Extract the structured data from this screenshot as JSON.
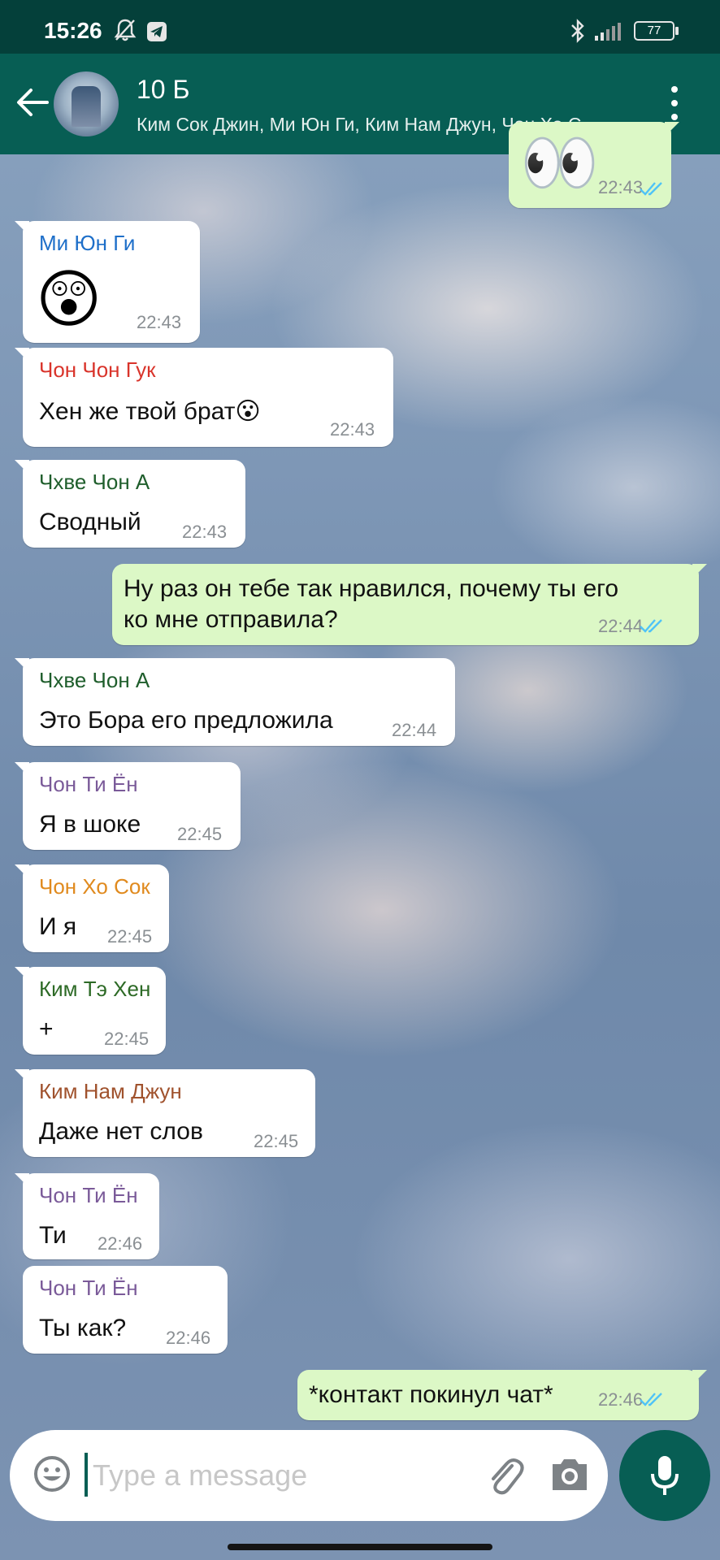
{
  "status_bar": {
    "time": "15:26",
    "battery": "77",
    "icons": [
      "mute-bell-icon",
      "telegram-icon",
      "bluetooth-icon",
      "signal-icon",
      "battery-icon"
    ]
  },
  "header": {
    "title": "10 Б",
    "subtitle": "Ким Сок Джин, Ми Юн Ги, Ким Нам Джун, Чон Хо С..",
    "icons": [
      "back-arrow-icon",
      "group-avatar",
      "more-vert-icon"
    ]
  },
  "colors": {
    "app_bar": "#075e54",
    "status_bar": "#04403a",
    "outgoing_bubble": "#dcf8c6",
    "incoming_bubble": "#ffffff",
    "read_ticks": "#4fc3f7"
  },
  "messages": [
    {
      "direction": "out",
      "emoji": "👀",
      "time": "22:43",
      "status": "read"
    },
    {
      "direction": "in",
      "sender": "Ми Юн Ги",
      "sender_color": "#1e6fc9",
      "emoji": "😲",
      "time": "22:43"
    },
    {
      "direction": "in",
      "sender": "Чон Чон Гук",
      "sender_color": "#d9342b",
      "text": "Хен же твой брат😮",
      "time": "22:43"
    },
    {
      "direction": "in",
      "sender": "Чхве Чон А",
      "sender_color": "#1f5e2c",
      "text": "Сводный",
      "time": "22:43"
    },
    {
      "direction": "out",
      "text_lines": [
        "Ну раз он тебе так нравился, почему ты его",
        "ко мне отправила?"
      ],
      "time": "22:44",
      "status": "read"
    },
    {
      "direction": "in",
      "sender": "Чхве Чон А",
      "sender_color": "#1f5e2c",
      "text": "Это Бора его предложила",
      "time": "22:44"
    },
    {
      "direction": "in",
      "sender": "Чон Ти Ён",
      "sender_color": "#7a5a99",
      "text": "Я в шоке",
      "time": "22:45"
    },
    {
      "direction": "in",
      "sender": "Чон Хо Сок",
      "sender_color": "#e08a1e",
      "text": "И я",
      "time": "22:45"
    },
    {
      "direction": "in",
      "sender": "Ким Тэ Хен",
      "sender_color": "#2d6a26",
      "text": "+",
      "time": "22:45"
    },
    {
      "direction": "in",
      "sender": "Ким Нам Джун",
      "sender_color": "#a0522d",
      "text": "Даже нет слов",
      "time": "22:45"
    },
    {
      "direction": "in",
      "sender": "Чон Ти Ён",
      "sender_color": "#7a5a99",
      "text": "Ти",
      "time": "22:46"
    },
    {
      "direction": "in",
      "sender": "Чон Ти Ён",
      "sender_color": "#7a5a99",
      "text": "Ты как?",
      "time": "22:46"
    },
    {
      "direction": "out",
      "text": "*контакт покинул чат*",
      "time": "22:46",
      "status": "read"
    }
  ],
  "composer": {
    "placeholder": "Type a message",
    "icons": [
      "emoji-icon",
      "attach-icon",
      "camera-icon",
      "mic-icon"
    ]
  }
}
